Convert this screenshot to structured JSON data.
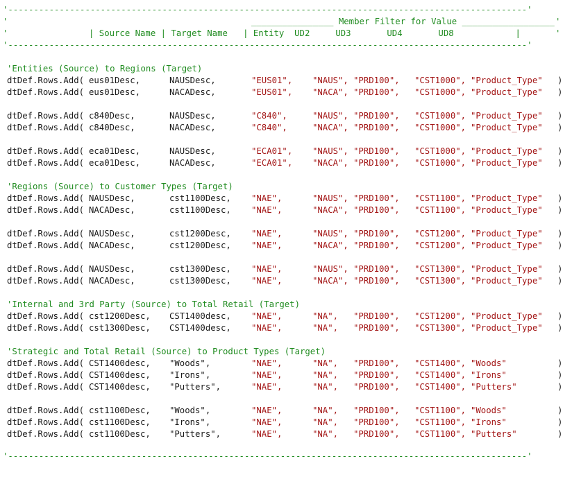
{
  "header": {
    "dash_line": "'-----------------------------------------------------------------------------------------------------'",
    "tick": "'",
    "filter_title_line": "________________ Member Filter for Value __________________",
    "columns_line": "| Source Name | Target Name   | Entity  UD2     UD3       UD4       UD8            |",
    "bottom_dash": "'-----------------------------------------------------------------------------------------------------'",
    "colors": {
      "comment": "#1f8b1f",
      "string": "#a31515",
      "code": "#1a1a1a"
    }
  },
  "prefix": "dtDef.Rows.Add(",
  "close": ")",
  "groups": [
    {
      "comment": "'Entities (Source) to Regions (Target)",
      "blocks": [
        [
          {
            "src": "eus01Desc,",
            "tgt": "NAUSDesc,",
            "entity": "\"EUS01\",",
            "ud2": "\"NAUS\",",
            "ud3": "\"PRD100\",",
            "ud4": "\"CST1000\",",
            "ud8": "\"Product_Type\""
          },
          {
            "src": "eus01Desc,",
            "tgt": "NACADesc,",
            "entity": "\"EUS01\",",
            "ud2": "\"NACA\",",
            "ud3": "\"PRD100\",",
            "ud4": "\"CST1000\",",
            "ud8": "\"Product_Type\""
          }
        ],
        [
          {
            "src": "c840Desc,",
            "tgt": "NAUSDesc,",
            "entity": "\"C840\",",
            "ud2": "\"NAUS\",",
            "ud3": "\"PRD100\",",
            "ud4": "\"CST1000\",",
            "ud8": "\"Product_Type\""
          },
          {
            "src": "c840Desc,",
            "tgt": "NACADesc,",
            "entity": "\"C840\",",
            "ud2": "\"NACA\",",
            "ud3": "\"PRD100\",",
            "ud4": "\"CST1000\",",
            "ud8": "\"Product_Type\""
          }
        ],
        [
          {
            "src": "eca01Desc,",
            "tgt": "NAUSDesc,",
            "entity": "\"ECA01\",",
            "ud2": "\"NAUS\",",
            "ud3": "\"PRD100\",",
            "ud4": "\"CST1000\",",
            "ud8": "\"Product_Type\""
          },
          {
            "src": "eca01Desc,",
            "tgt": "NACADesc,",
            "entity": "\"ECA01\",",
            "ud2": "\"NACA\",",
            "ud3": "\"PRD100\",",
            "ud4": "\"CST1000\",",
            "ud8": "\"Product_Type\""
          }
        ]
      ]
    },
    {
      "comment": "'Regions (Source) to Customer Types (Target)",
      "blocks": [
        [
          {
            "src": "NAUSDesc,",
            "tgt": "cst1100Desc,",
            "entity": "\"NAE\",",
            "ud2": "\"NAUS\",",
            "ud3": "\"PRD100\",",
            "ud4": "\"CST1100\",",
            "ud8": "\"Product_Type\""
          },
          {
            "src": "NACADesc,",
            "tgt": "cst1100Desc,",
            "entity": "\"NAE\",",
            "ud2": "\"NACA\",",
            "ud3": "\"PRD100\",",
            "ud4": "\"CST1100\",",
            "ud8": "\"Product_Type\""
          }
        ],
        [
          {
            "src": "NAUSDesc,",
            "tgt": "cst1200Desc,",
            "entity": "\"NAE\",",
            "ud2": "\"NAUS\",",
            "ud3": "\"PRD100\",",
            "ud4": "\"CST1200\",",
            "ud8": "\"Product_Type\""
          },
          {
            "src": "NACADesc,",
            "tgt": "cst1200Desc,",
            "entity": "\"NAE\",",
            "ud2": "\"NACA\",",
            "ud3": "\"PRD100\",",
            "ud4": "\"CST1200\",",
            "ud8": "\"Product_Type\""
          }
        ],
        [
          {
            "src": "NAUSDesc,",
            "tgt": "cst1300Desc,",
            "entity": "\"NAE\",",
            "ud2": "\"NAUS\",",
            "ud3": "\"PRD100\",",
            "ud4": "\"CST1300\",",
            "ud8": "\"Product_Type\""
          },
          {
            "src": "NACADesc,",
            "tgt": "cst1300Desc,",
            "entity": "\"NAE\",",
            "ud2": "\"NACA\",",
            "ud3": "\"PRD100\",",
            "ud4": "\"CST1300\",",
            "ud8": "\"Product_Type\""
          }
        ]
      ]
    },
    {
      "comment": "'Internal and 3rd Party (Source) to Total Retail (Target)",
      "blocks": [
        [
          {
            "src": "cst1200Desc,",
            "tgt": "CST1400desc,",
            "entity": "\"NAE\",",
            "ud2": "\"NA\",",
            "ud3": "\"PRD100\",",
            "ud4": "\"CST1200\",",
            "ud8": "\"Product_Type\""
          },
          {
            "src": "cst1300Desc,",
            "tgt": "CST1400desc,",
            "entity": "\"NAE\",",
            "ud2": "\"NA\",",
            "ud3": "\"PRD100\",",
            "ud4": "\"CST1300\",",
            "ud8": "\"Product_Type\""
          }
        ]
      ]
    },
    {
      "comment": "'Strategic and Total Retail (Source) to Product Types (Target)",
      "blocks": [
        [
          {
            "src": "CST1400desc,",
            "tgt": "\"Woods\",",
            "entity": "\"NAE\",",
            "ud2": "\"NA\",",
            "ud3": "\"PRD100\",",
            "ud4": "\"CST1400\",",
            "ud8": "\"Woods\""
          },
          {
            "src": "CST1400desc,",
            "tgt": "\"Irons\",",
            "entity": "\"NAE\",",
            "ud2": "\"NA\",",
            "ud3": "\"PRD100\",",
            "ud4": "\"CST1400\",",
            "ud8": "\"Irons\""
          },
          {
            "src": "CST1400desc,",
            "tgt": "\"Putters\",",
            "entity": "\"NAE\",",
            "ud2": "\"NA\",",
            "ud3": "\"PRD100\",",
            "ud4": "\"CST1400\",",
            "ud8": "\"Putters\""
          }
        ],
        [
          {
            "src": "cst1100Desc,",
            "tgt": "\"Woods\",",
            "entity": "\"NAE\",",
            "ud2": "\"NA\",",
            "ud3": "\"PRD100\",",
            "ud4": "\"CST1100\",",
            "ud8": "\"Woods\""
          },
          {
            "src": "cst1100Desc,",
            "tgt": "\"Irons\",",
            "entity": "\"NAE\",",
            "ud2": "\"NA\",",
            "ud3": "\"PRD100\",",
            "ud4": "\"CST1100\",",
            "ud8": "\"Irons\""
          },
          {
            "src": "cst1100Desc,",
            "tgt": "\"Putters\",",
            "entity": "\"NAE\",",
            "ud2": "\"NA\",",
            "ud3": "\"PRD100\",",
            "ud4": "\"CST1100\",",
            "ud8": "\"Putters\""
          }
        ]
      ]
    }
  ]
}
